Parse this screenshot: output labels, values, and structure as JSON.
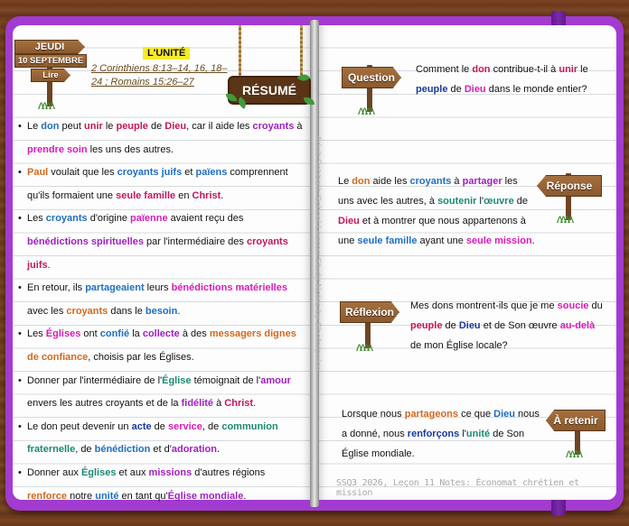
{
  "date": {
    "day": "JEUDI",
    "date": "10 SEPTEMBRE",
    "read": "Lire"
  },
  "lesson": {
    "label": "L'UNITÉ",
    "refs": "2 Corinthiens 8:13–14, 16, 18–24 ; Romains 15:26–27",
    "summary_sign": "RÉSUMÉ"
  },
  "bullets": [
    [
      [
        "Le ",
        ""
      ],
      [
        "don",
        "c-b"
      ],
      [
        " peut ",
        ""
      ],
      [
        "unir",
        "c-r"
      ],
      [
        " le ",
        ""
      ],
      [
        "peuple",
        "c-r"
      ],
      [
        " de ",
        ""
      ],
      [
        "Dieu",
        "c-r"
      ],
      [
        ", car il aide les ",
        ""
      ],
      [
        "croyants",
        "c-p"
      ],
      [
        " à ",
        ""
      ],
      [
        "prendre soin",
        "c-m"
      ],
      [
        " les uns des autres.",
        ""
      ]
    ],
    [
      [
        "Paul",
        "c-o"
      ],
      [
        " voulait que les ",
        ""
      ],
      [
        "croyants juifs",
        "c-b"
      ],
      [
        " et ",
        ""
      ],
      [
        "païens",
        "c-b"
      ],
      [
        " comprennent qu'ils formaient une ",
        ""
      ],
      [
        "seule famille",
        "c-r"
      ],
      [
        " en ",
        ""
      ],
      [
        "Christ",
        "c-r"
      ],
      [
        ".",
        ""
      ]
    ],
    [
      [
        "Les ",
        ""
      ],
      [
        "croyants",
        "c-b"
      ],
      [
        " d'origine ",
        ""
      ],
      [
        "païenne",
        "c-m"
      ],
      [
        " avaient reçu des ",
        ""
      ],
      [
        "bénédictions spirituelles",
        "c-p"
      ],
      [
        " par l'intermédiaire des ",
        ""
      ],
      [
        "croyants juifs",
        "c-r"
      ],
      [
        ".",
        ""
      ]
    ],
    [
      [
        "En retour, ils ",
        ""
      ],
      [
        "partageaient",
        "c-b"
      ],
      [
        " leurs ",
        ""
      ],
      [
        "bénédictions matérielles",
        "c-m"
      ],
      [
        " avec les ",
        ""
      ],
      [
        "croyants",
        "c-o"
      ],
      [
        " dans le ",
        ""
      ],
      [
        "besoin",
        "c-b"
      ],
      [
        ".",
        ""
      ]
    ],
    [
      [
        "Les ",
        ""
      ],
      [
        "Églises",
        "c-m"
      ],
      [
        " ont ",
        ""
      ],
      [
        "confié",
        "c-b"
      ],
      [
        " la ",
        ""
      ],
      [
        "collecte",
        "c-p"
      ],
      [
        " à des ",
        ""
      ],
      [
        "messagers dignes de confiance",
        "c-o"
      ],
      [
        ", choisis par les Églises.",
        ""
      ]
    ],
    [
      [
        "Donner par l'intermédiaire de l'",
        ""
      ],
      [
        "Église",
        "c-g"
      ],
      [
        " témoignait de l'",
        ""
      ],
      [
        "amour",
        "c-p"
      ],
      [
        " envers les autres croyants et de la ",
        ""
      ],
      [
        "fidélité",
        "c-p"
      ],
      [
        " à ",
        ""
      ],
      [
        "Christ",
        "c-r"
      ],
      [
        ".",
        ""
      ]
    ],
    [
      [
        "Le don peut devenir un ",
        ""
      ],
      [
        "acte",
        "c-n"
      ],
      [
        " de ",
        ""
      ],
      [
        "service",
        "c-m"
      ],
      [
        ", de ",
        ""
      ],
      [
        "communion fraternelle",
        "c-g"
      ],
      [
        ", de ",
        ""
      ],
      [
        "bénédiction",
        "c-b"
      ],
      [
        " et d'",
        ""
      ],
      [
        "adoration",
        "c-p"
      ],
      [
        ".",
        ""
      ]
    ],
    [
      [
        "Donner aux ",
        ""
      ],
      [
        "Églises",
        "c-g"
      ],
      [
        " et aux ",
        ""
      ],
      [
        "missions",
        "c-p"
      ],
      [
        " d'autres régions ",
        ""
      ],
      [
        "renforce",
        "c-o"
      ],
      [
        " notre ",
        ""
      ],
      [
        "unité",
        "c-b"
      ],
      [
        " en tant qu'",
        ""
      ],
      [
        "Église mondiale",
        "c-p"
      ],
      [
        ".",
        ""
      ]
    ]
  ],
  "question": {
    "sign": "Question",
    "text": [
      [
        "Comment le ",
        ""
      ],
      [
        "don",
        "c-r"
      ],
      [
        " contribue-t-il à ",
        ""
      ],
      [
        "unir",
        "c-r"
      ],
      [
        " le ",
        ""
      ],
      [
        "peuple",
        "c-n"
      ],
      [
        " de ",
        ""
      ],
      [
        "Dieu",
        "c-m"
      ],
      [
        " dans le monde entier?",
        ""
      ]
    ]
  },
  "reponse": {
    "sign": "Réponse",
    "text": [
      [
        "Le ",
        ""
      ],
      [
        "don",
        "c-o"
      ],
      [
        " aide les ",
        ""
      ],
      [
        "croyants",
        "c-b"
      ],
      [
        " à ",
        ""
      ],
      [
        "partager",
        "c-p"
      ],
      [
        " les uns avec les autres, à ",
        ""
      ],
      [
        "soutenir",
        "c-g"
      ],
      [
        " l'",
        ""
      ],
      [
        "œuvre",
        "c-g"
      ],
      [
        " de ",
        ""
      ],
      [
        "Dieu",
        "c-r"
      ],
      [
        " et à montrer que nous appartenons à une ",
        ""
      ],
      [
        "seule famille",
        "c-b"
      ],
      [
        " ayant une ",
        ""
      ],
      [
        "seule mission",
        "c-m"
      ],
      [
        ".",
        ""
      ]
    ]
  },
  "reflexion": {
    "sign": "Réflexion",
    "text": [
      [
        "Mes dons montrent-ils que je me ",
        ""
      ],
      [
        "soucie",
        "c-m"
      ],
      [
        " du ",
        ""
      ],
      [
        "peuple",
        "c-r"
      ],
      [
        " de ",
        ""
      ],
      [
        "Dieu",
        "c-n"
      ],
      [
        " et de Son œuvre ",
        ""
      ],
      [
        "au-delà",
        "c-m"
      ],
      [
        " de mon Église locale?",
        ""
      ]
    ]
  },
  "retenir": {
    "sign": "À retenir",
    "text": [
      [
        "Lorsque nous ",
        ""
      ],
      [
        "partageons",
        "c-o"
      ],
      [
        " ce que ",
        ""
      ],
      [
        "Dieu",
        "c-b"
      ],
      [
        " nous a donné, nous ",
        ""
      ],
      [
        "renforçons",
        "c-n"
      ],
      [
        " l'",
        ""
      ],
      [
        "unité",
        "c-g"
      ],
      [
        " de Son Église mondiale.",
        ""
      ]
    ]
  },
  "spine_text": "Adult Sabbath School Lesson Study Notes by Shofarpulse",
  "footer": "SSQ3 2026, Leçon 11 Notes: Économat chrétien et mission"
}
